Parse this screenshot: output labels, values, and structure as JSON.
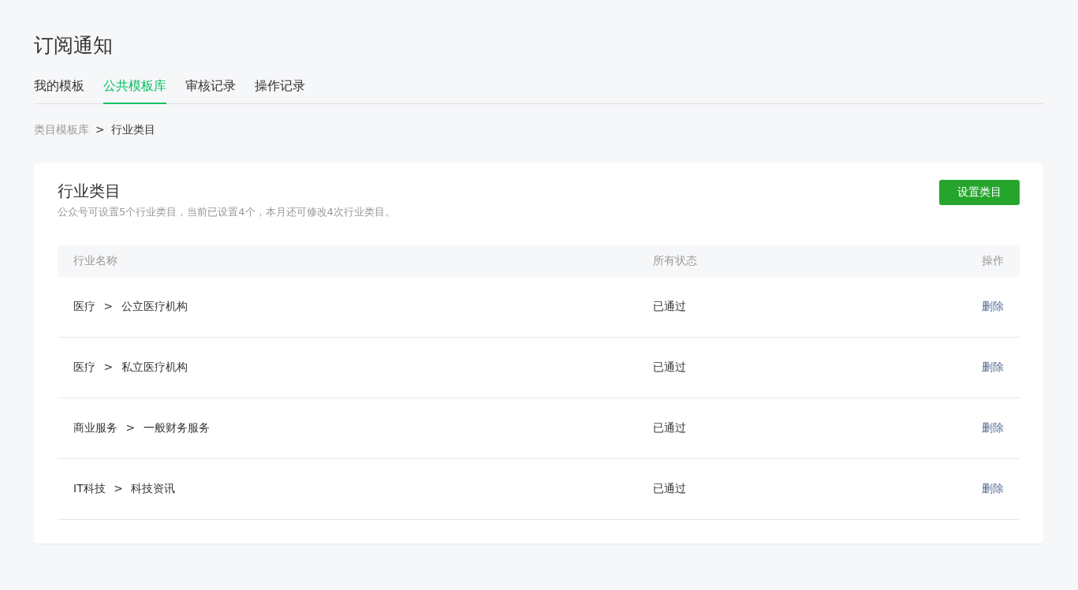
{
  "page_title": "订阅通知",
  "tabs": [
    {
      "label": "我的模板",
      "selected": false
    },
    {
      "label": "公共模板库",
      "selected": true
    },
    {
      "label": "审核记录",
      "selected": false
    },
    {
      "label": "操作记录",
      "selected": false
    }
  ],
  "breadcrumb": {
    "separator": ">",
    "items": [
      {
        "label": "类目模板库",
        "current": false
      },
      {
        "label": "行业类目",
        "current": true
      }
    ]
  },
  "card": {
    "title": "行业类目",
    "description": "公众号可设置5个行业类目，当前已设置4个，本月还可修改4次行业类目。",
    "button": "设置类目",
    "table": {
      "columns": [
        "行业名称",
        "所有状态",
        "操作"
      ],
      "rows": [
        {
          "category": "医疗 > 公立医疗机构",
          "status": "已通过",
          "action": "删除"
        },
        {
          "category": "医疗 > 私立医疗机构",
          "status": "已通过",
          "action": "删除"
        },
        {
          "category": "商业服务 > 一般财务服务",
          "status": "已通过",
          "action": "删除"
        },
        {
          "category": "IT科技 > 科技资讯",
          "status": "已通过",
          "action": "删除"
        }
      ]
    }
  }
}
